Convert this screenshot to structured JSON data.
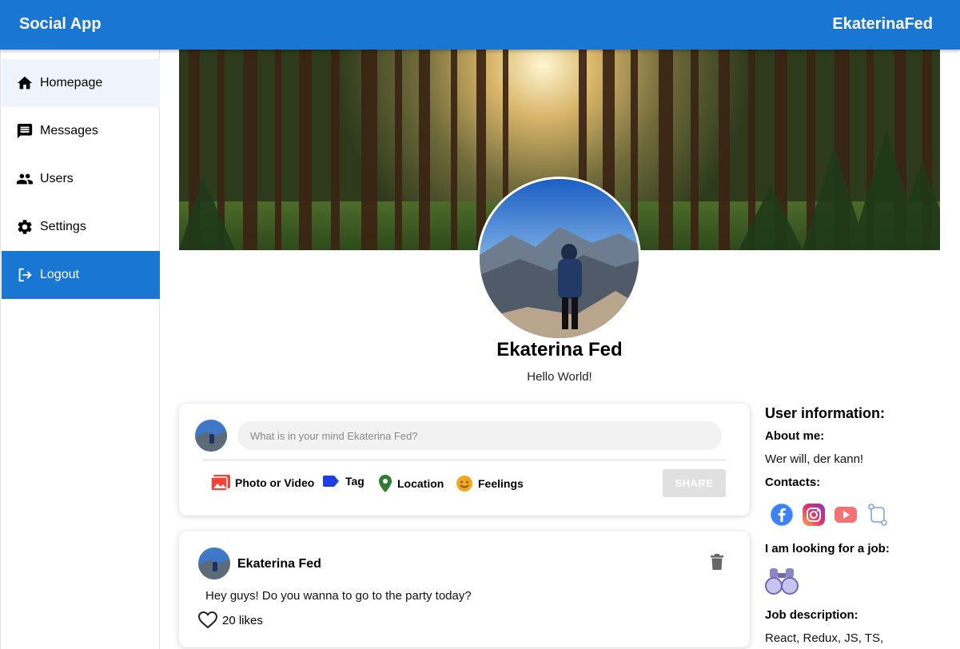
{
  "app": {
    "title": "Social App",
    "username": "EkaterinaFed"
  },
  "sidebar": {
    "items": [
      {
        "label": "Homepage",
        "icon": "home-icon"
      },
      {
        "label": "Messages",
        "icon": "message-icon"
      },
      {
        "label": "Users",
        "icon": "users-icon"
      },
      {
        "label": "Settings",
        "icon": "gear-icon"
      },
      {
        "label": "Logout",
        "icon": "logout-icon"
      }
    ]
  },
  "profile": {
    "name": "Ekaterina Fed",
    "bio": "Hello World!"
  },
  "share": {
    "placeholder": "What is in your mind Ekaterina Fed?",
    "options": [
      {
        "label": "Photo or Video",
        "icon": "photo-icon",
        "color": "#f44336"
      },
      {
        "label": "Tag",
        "icon": "tag-icon",
        "color": "#1e3ee6"
      },
      {
        "label": "Location",
        "icon": "location-icon",
        "color": "#2e7d32"
      },
      {
        "label": "Feelings",
        "icon": "smile-icon",
        "color": "#f2a81d"
      }
    ],
    "button": "SHARE"
  },
  "post": {
    "author": "Ekaterina Fed",
    "text": "Hey guys! Do you wanna to go to the party today?",
    "likes": "20 likes"
  },
  "user_info": {
    "title": "User information:",
    "about_label": "About me:",
    "about_value": "Wer will, der kann!",
    "contacts_label": "Contacts:",
    "contacts": [
      "facebook-icon",
      "instagram-icon",
      "youtube-icon",
      "github-icon"
    ],
    "job_label": "I am looking for a job:",
    "job_icon": "binoculars-icon",
    "job_desc_label": "Job description:",
    "job_desc_value": "React, Redux, JS, TS,"
  },
  "colors": {
    "primary": "#1976d2",
    "sidebar_selected": "#edf4fc"
  }
}
